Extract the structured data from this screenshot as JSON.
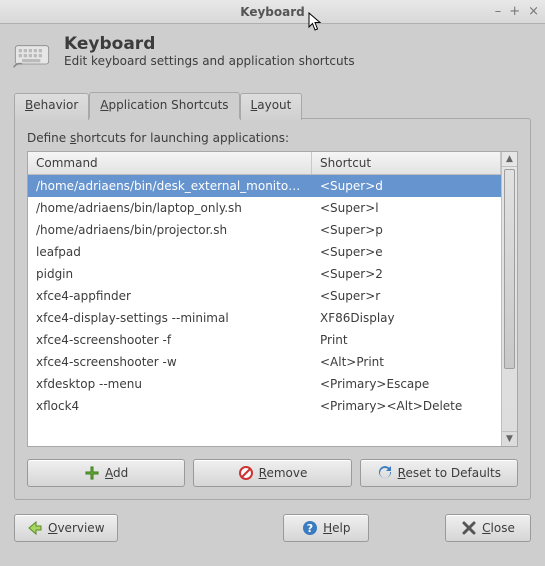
{
  "window": {
    "title": "Keyboard"
  },
  "header": {
    "title": "Keyboard",
    "subtitle": "Edit keyboard settings and application shortcuts"
  },
  "tabs": {
    "behavior": "Behavior",
    "app_shortcuts": "Application Shortcuts",
    "layout": "Layout"
  },
  "instruction_pre": "Define ",
  "instruction_mn": "s",
  "instruction_post": "hortcuts for launching applications:",
  "columns": {
    "command": "Command",
    "shortcut": "Shortcut"
  },
  "rows": [
    {
      "command": "/home/adriaens/bin/desk_external_monitor.sh",
      "shortcut": "<Super>d",
      "selected": true
    },
    {
      "command": "/home/adriaens/bin/laptop_only.sh",
      "shortcut": "<Super>l"
    },
    {
      "command": "/home/adriaens/bin/projector.sh",
      "shortcut": "<Super>p"
    },
    {
      "command": "leafpad",
      "shortcut": "<Super>e"
    },
    {
      "command": "pidgin",
      "shortcut": "<Super>2"
    },
    {
      "command": "xfce4-appfinder",
      "shortcut": "<Super>r"
    },
    {
      "command": "xfce4-display-settings --minimal",
      "shortcut": "XF86Display"
    },
    {
      "command": "xfce4-screenshooter -f",
      "shortcut": "Print"
    },
    {
      "command": "xfce4-screenshooter -w",
      "shortcut": "<Alt>Print"
    },
    {
      "command": "xfdesktop --menu",
      "shortcut": "<Primary>Escape"
    },
    {
      "command": "xflock4",
      "shortcut": "<Primary><Alt>Delete"
    }
  ],
  "buttons": {
    "add_mn": "A",
    "add_post": "dd",
    "remove_mn": "R",
    "remove_post": "emove",
    "reset_mid": "eset to Defaults",
    "reset_mn": "R",
    "overview_mn": "O",
    "overview_post": "verview",
    "help_mn": "H",
    "help_post": "elp",
    "close_mn": "C",
    "close_post": "lose"
  }
}
